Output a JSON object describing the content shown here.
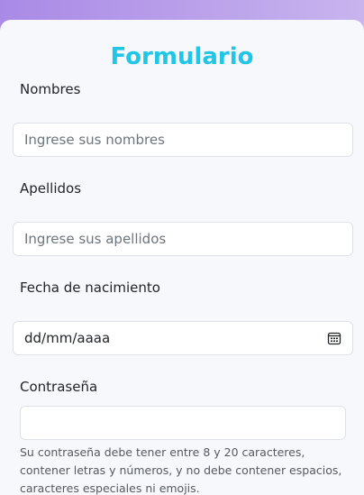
{
  "form": {
    "title": "Formulario",
    "fields": {
      "nombres": {
        "label": "Nombres",
        "placeholder": "Ingrese sus nombres"
      },
      "apellidos": {
        "label": "Apellidos",
        "placeholder": "Ingrese sus apellidos"
      },
      "fecha": {
        "label": "Fecha de nacimiento",
        "value": "dd/mm/aaaa",
        "icon": "calendar-icon"
      },
      "contrasena": {
        "label": "Contraseña",
        "value": "",
        "help": "Su contraseña debe tener entre 8 y 20 caracteres, contener letras y números, y no debe contener espacios, caracteres especiales ni emojis."
      }
    }
  },
  "colors": {
    "title": "#1fc6e6",
    "background_gradient_start": "#a98ae6",
    "background_gradient_end": "#c9b4ee",
    "card": "#f7f8fb"
  }
}
